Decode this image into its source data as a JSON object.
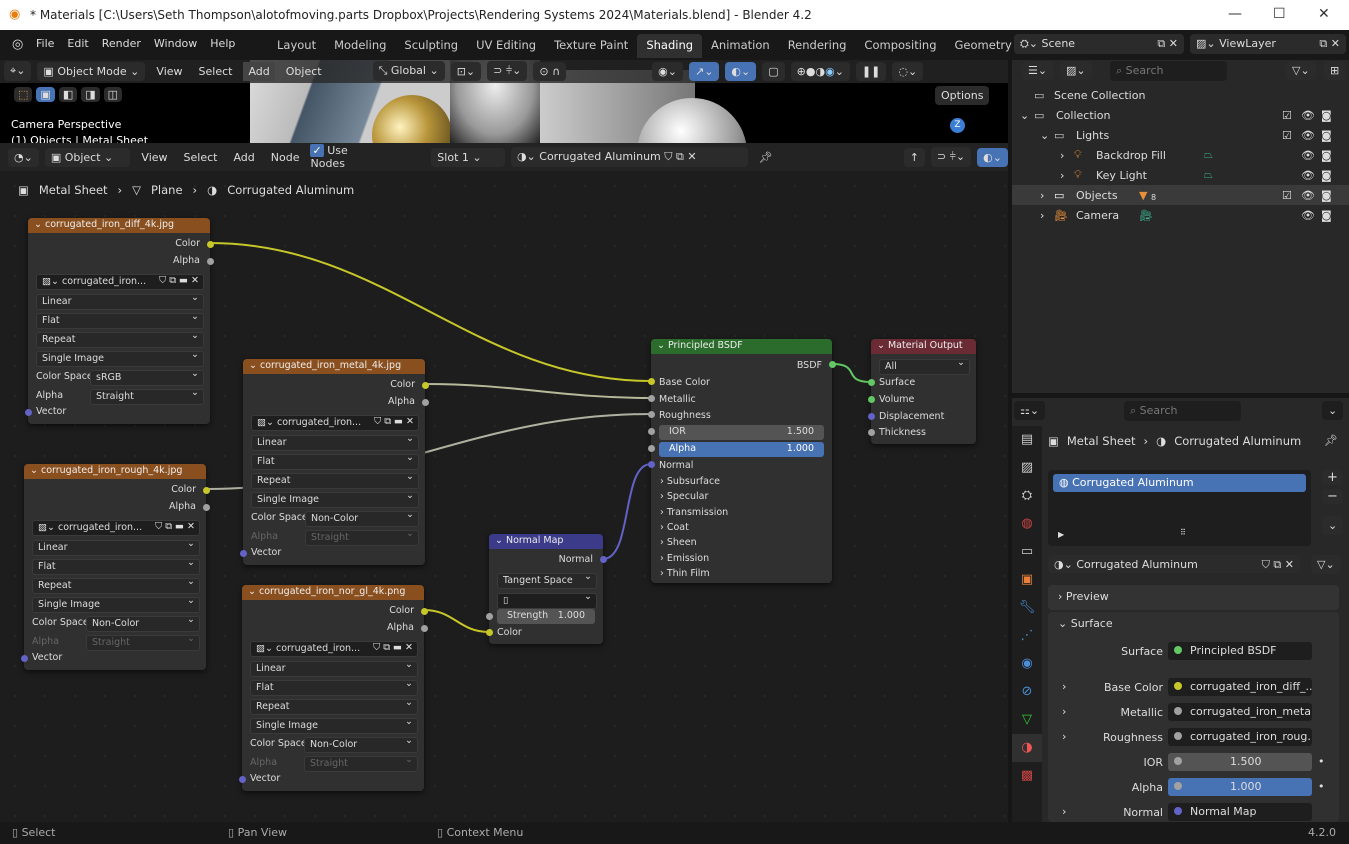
{
  "title": "* Materials [C:\\Users\\Seth Thompson\\alotofmoving.parts Dropbox\\Projects\\Rendering Systems 2024\\Materials.blend] - Blender 4.2",
  "menu": [
    "File",
    "Edit",
    "Render",
    "Window",
    "Help"
  ],
  "workspaces": [
    "Layout",
    "Modeling",
    "Sculpting",
    "UV Editing",
    "Texture Paint",
    "Shading",
    "Animation",
    "Rendering",
    "Compositing",
    "Geometry N"
  ],
  "active_workspace": "Shading",
  "viewport": {
    "mode": "Object Mode",
    "menus": [
      "View",
      "Select",
      "Add",
      "Object"
    ],
    "orientation": "Global",
    "options": "Options",
    "camera_label": "Camera Perspective",
    "object_label": "(1) Objects | Metal Sheet",
    "gizmo_axis": "Z"
  },
  "node_header": {
    "type": "Object",
    "menus": [
      "View",
      "Select",
      "Add",
      "Node"
    ],
    "use_nodes": "Use Nodes",
    "slot": "Slot 1",
    "material": "Corrugated Aluminum"
  },
  "breadcrumb": [
    "Metal Sheet",
    "Plane",
    "Corrugated Aluminum"
  ],
  "image_nodes": [
    {
      "title": "corrugated_iron_diff_4k.jpg",
      "image": "corrugated_iron...",
      "interp": "Linear",
      "proj": "Flat",
      "ext": "Repeat",
      "source": "Single Image",
      "cs_label": "Color Space",
      "cs": "sRGB",
      "alpha_label": "Alpha",
      "alpha": "Straight",
      "outputs": [
        "Color",
        "Alpha"
      ],
      "vector": "Vector",
      "alpha_disabled": false
    },
    {
      "title": "corrugated_iron_metal_4k.jpg",
      "image": "corrugated_iron...",
      "interp": "Linear",
      "proj": "Flat",
      "ext": "Repeat",
      "source": "Single Image",
      "cs_label": "Color Space",
      "cs": "Non-Color",
      "alpha_label": "Alpha",
      "alpha": "Straight",
      "outputs": [
        "Color",
        "Alpha"
      ],
      "vector": "Vector",
      "alpha_disabled": true
    },
    {
      "title": "corrugated_iron_rough_4k.jpg",
      "image": "corrugated_iron...",
      "interp": "Linear",
      "proj": "Flat",
      "ext": "Repeat",
      "source": "Single Image",
      "cs_label": "Color Space",
      "cs": "Non-Color",
      "alpha_label": "Alpha",
      "alpha": "Straight",
      "outputs": [
        "Color",
        "Alpha"
      ],
      "vector": "Vector",
      "alpha_disabled": true
    },
    {
      "title": "corrugated_iron_nor_gl_4k.png",
      "image": "corrugated_iron...",
      "interp": "Linear",
      "proj": "Flat",
      "ext": "Repeat",
      "source": "Single Image",
      "cs_label": "Color Space",
      "cs": "Non-Color",
      "alpha_label": "Alpha",
      "alpha": "Straight",
      "outputs": [
        "Color",
        "Alpha"
      ],
      "vector": "Vector",
      "alpha_disabled": true
    }
  ],
  "normal_map": {
    "title": "Normal Map",
    "output": "Normal",
    "space": "Tangent Space",
    "strength_label": "Strength",
    "strength": "1.000",
    "input": "Color"
  },
  "bsdf": {
    "title": "Principled BSDF",
    "output": "BSDF",
    "inputs": [
      "Base Color",
      "Metallic",
      "Roughness"
    ],
    "ior_label": "IOR",
    "ior": "1.500",
    "alpha_label": "Alpha",
    "alpha": "1.000",
    "normal": "Normal",
    "panels": [
      "Subsurface",
      "Specular",
      "Transmission",
      "Coat",
      "Sheen",
      "Emission",
      "Thin Film"
    ]
  },
  "output_node": {
    "title": "Material Output",
    "target": "All",
    "inputs": [
      "Surface",
      "Volume",
      "Displacement",
      "Thickness"
    ]
  },
  "outliner": {
    "scene": "Scene",
    "view_layer": "ViewLayer",
    "search_placeholder": "Search",
    "items": [
      {
        "label": "Scene Collection"
      },
      {
        "label": "Collection"
      },
      {
        "label": "Lights"
      },
      {
        "label": "Backdrop Fill"
      },
      {
        "label": "Key Light"
      },
      {
        "label": "Objects",
        "badge": "8"
      },
      {
        "label": "Camera"
      }
    ]
  },
  "properties": {
    "search_placeholder": "Search",
    "object": "Metal Sheet",
    "material": "Corrugated Aluminum",
    "slot_item": "Corrugated Aluminum",
    "material_field": "Corrugated Aluminum",
    "preview": "Preview",
    "surface_panel": "Surface",
    "rows": [
      {
        "label": "Surface",
        "value": "Principled BSDF"
      },
      {
        "label": "Base Color",
        "value": "corrugated_iron_diff_..."
      },
      {
        "label": "Metallic",
        "value": "corrugated_iron_meta..."
      },
      {
        "label": "Roughness",
        "value": "corrugated_iron_roug..."
      },
      {
        "label": "IOR",
        "value": "1.500"
      },
      {
        "label": "Alpha",
        "value": "1.000"
      },
      {
        "label": "Normal",
        "value": "Normal Map"
      }
    ]
  },
  "status": {
    "select": "Select",
    "pan": "Pan View",
    "context": "Context Menu",
    "version": "4.2.0"
  },
  "colors": {
    "accent": "#4772b3",
    "image_header": "#8a4f1e",
    "shader_header": "#2b6b2b",
    "output_header": "#6b2b35",
    "vector_header": "#3b3b8a",
    "color_socket": "#c7c729",
    "gray_socket": "#a1a1a1",
    "vector_socket": "#6363c7",
    "shader_socket": "#63c763"
  }
}
